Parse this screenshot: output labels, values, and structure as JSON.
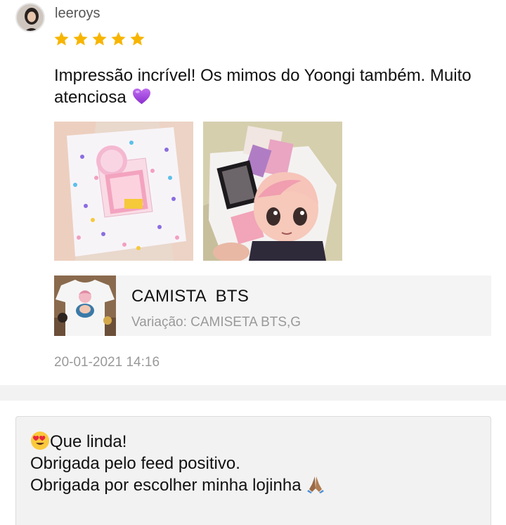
{
  "review": {
    "username": "leeroys",
    "rating": 5,
    "max_rating": 5,
    "text": "Impressão incrível! Os mimos do Yoongi também. Muito atenciosa",
    "text_emoji": "purple-heart-emoji",
    "photos": [
      {
        "icon": "photo-tshirt-package-stars"
      },
      {
        "icon": "photo-tshirt-chibi-photocards"
      }
    ],
    "product": {
      "name": "CAMISTA  BTS",
      "variation": "Variação: CAMISETA BTS,G"
    },
    "timestamp": "20-01-2021 14:16"
  },
  "seller_reply": {
    "lines": [
      "Que linda!",
      "Obrigada pelo feed positivo.",
      "Obrigada por escolher minha lojinha"
    ],
    "leading_emoji": "heart-eyes-emoji",
    "trailing_emoji": "folded-hands-emoji"
  },
  "colors": {
    "star": "#f7b500",
    "heart": "#a24ce0",
    "muted_text": "#999999",
    "product_bg": "#f4f4f4"
  }
}
